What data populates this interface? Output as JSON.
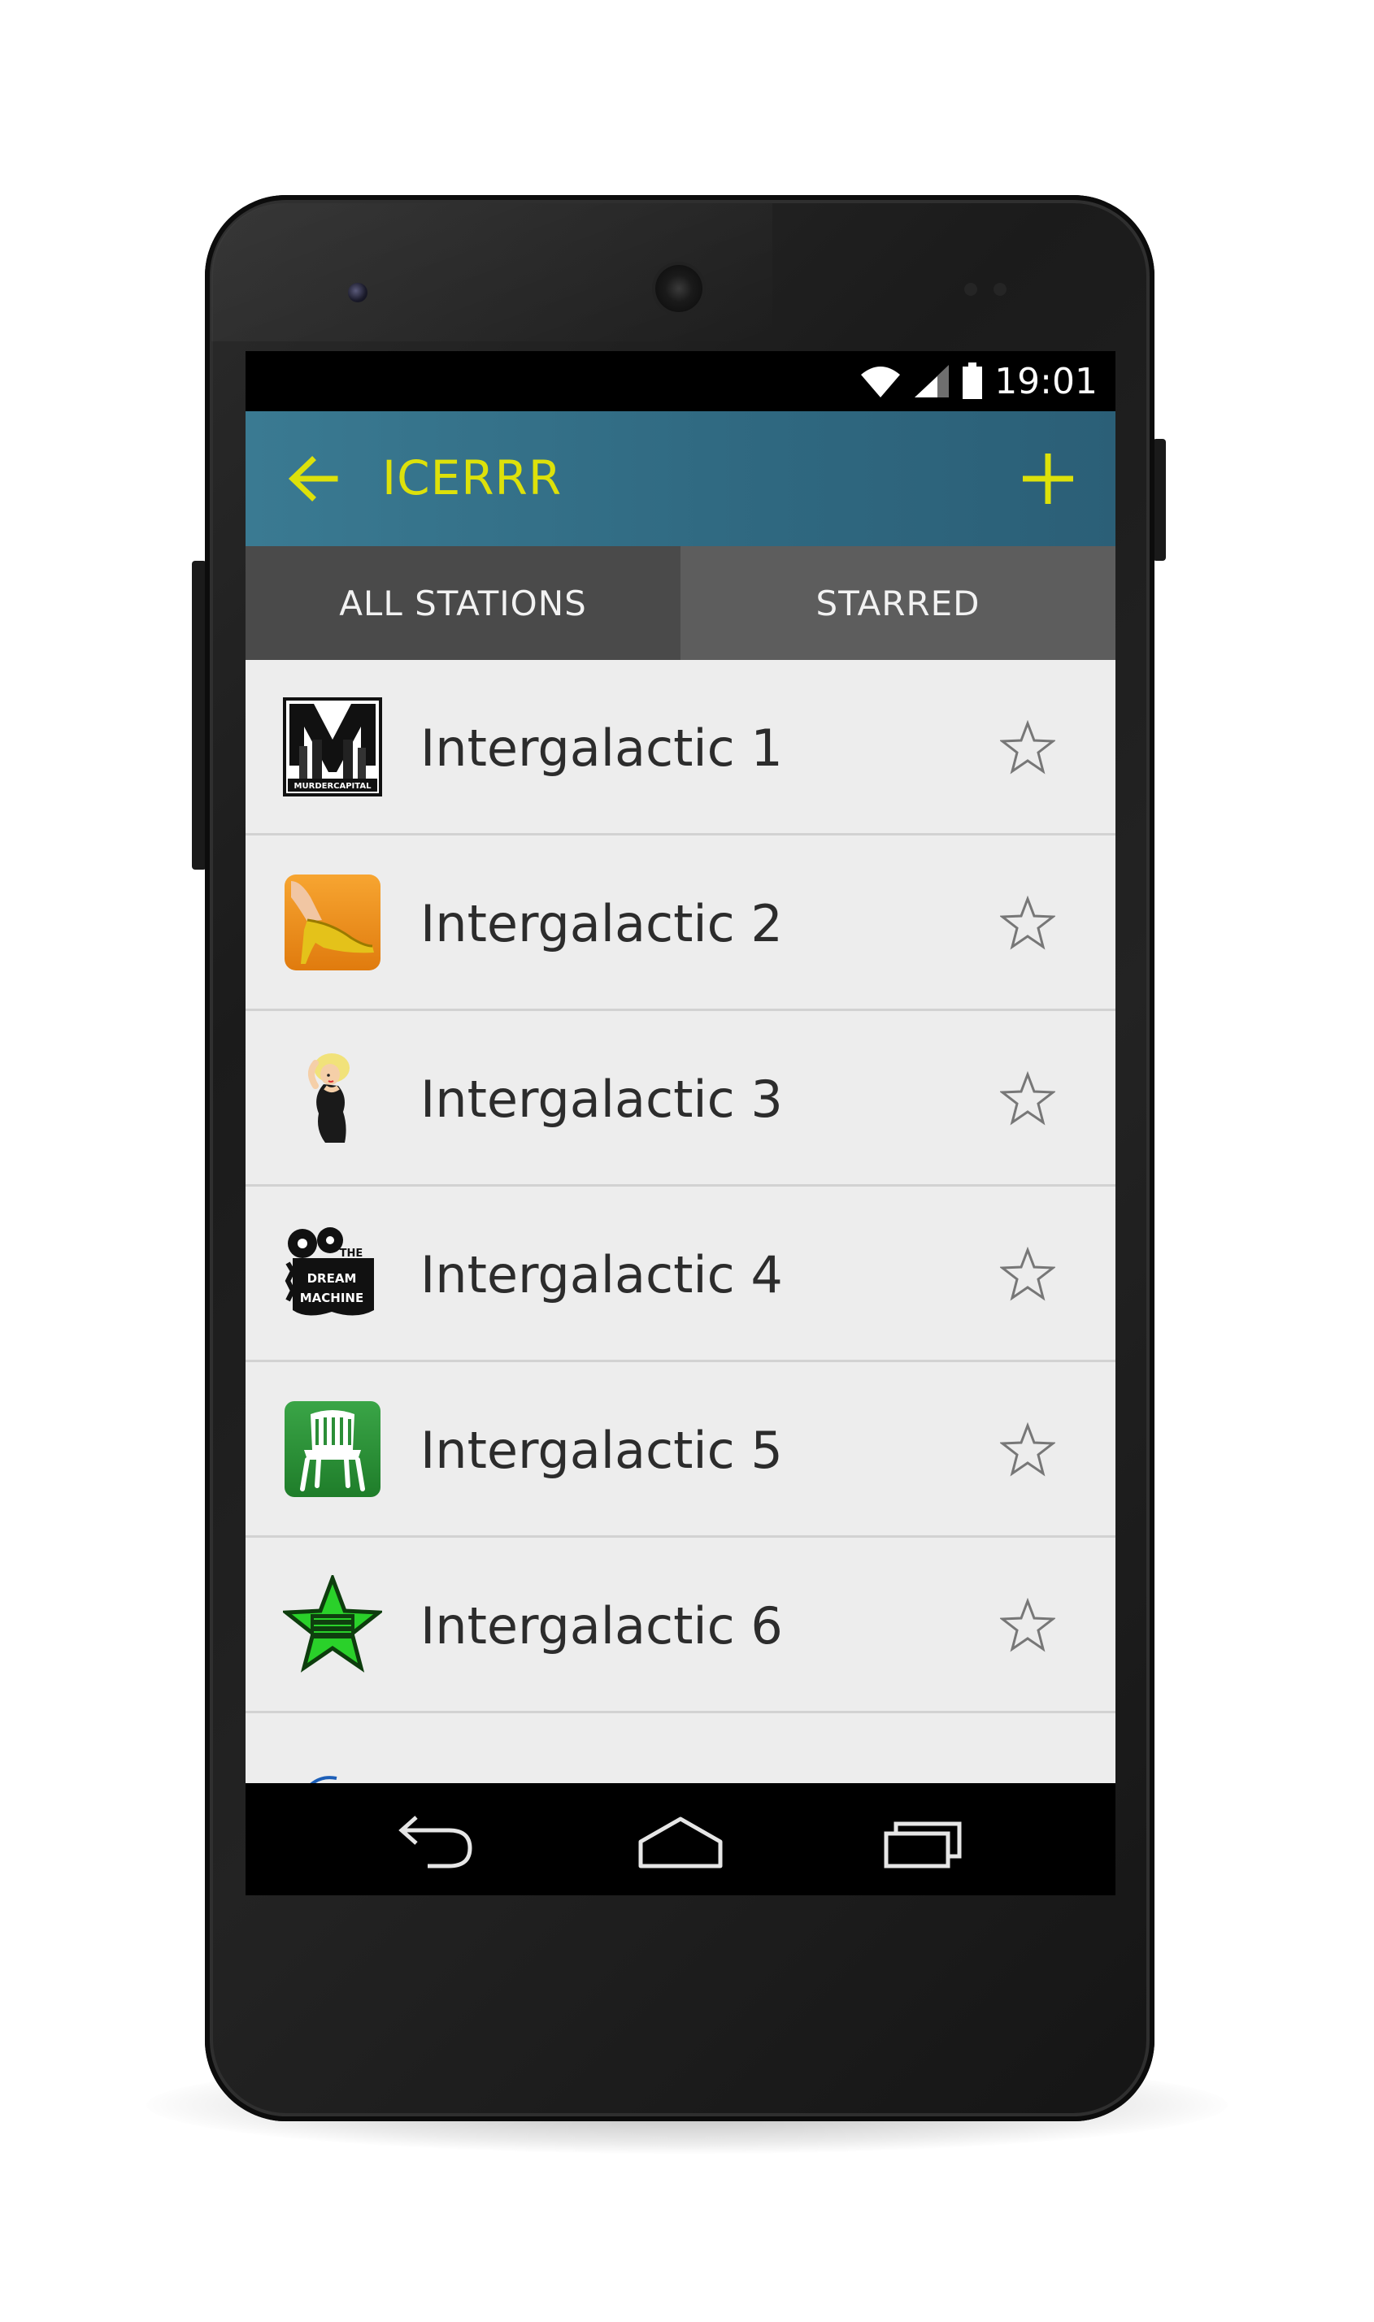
{
  "status_bar": {
    "time": "19:01"
  },
  "action_bar": {
    "title": "ICERRR",
    "accent_color": "#dde10a"
  },
  "tabs": [
    {
      "label": "ALL STATIONS",
      "selected": true
    },
    {
      "label": "STARRED",
      "selected": false
    }
  ],
  "stations": [
    {
      "name": "Intergalactic 1",
      "icon": "murdercapital-logo",
      "logo_text": "MURDERCAPITAL",
      "starred": false
    },
    {
      "name": "Intergalactic 2",
      "icon": "high-heel-shoe",
      "starred": false
    },
    {
      "name": "Intergalactic 3",
      "icon": "pinup-girl",
      "starred": false
    },
    {
      "name": "Intergalactic 4",
      "icon": "dream-machine-logo",
      "logo_text": "THE DREAM MACHINE",
      "starred": false
    },
    {
      "name": "Intergalactic 5",
      "icon": "plastic-chair",
      "starred": false
    },
    {
      "name": "Intergalactic 6",
      "icon": "green-star-radio",
      "starred": false
    }
  ],
  "colors": {
    "action_bar": "#2f6880",
    "tab_selected": "#4a4a4a",
    "tab_unselected": "#5d5d5d",
    "list_background": "#ededed"
  }
}
